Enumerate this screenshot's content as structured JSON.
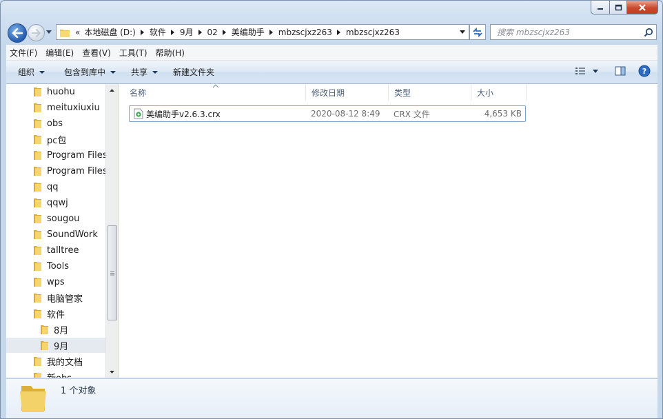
{
  "window": {
    "caption_buttons": [
      "minimize-icon",
      "maximize-icon",
      "close-icon"
    ]
  },
  "nav": {
    "address": {
      "overflow": "«",
      "breadcrumbs": [
        "本地磁盘 (D:)",
        "软件",
        "9月",
        "02",
        "美编助手",
        "mbzscjxz263",
        "mbzscjxz263"
      ]
    },
    "search_placeholder": "搜索 mbzscjxz263"
  },
  "menu": [
    "文件(F)",
    "编辑(E)",
    "查看(V)",
    "工具(T)",
    "帮助(H)"
  ],
  "toolbar": {
    "organize": "组织",
    "include_in_library": "包含到库中",
    "share": "共享",
    "new_folder": "新建文件夹"
  },
  "tree": {
    "items": [
      {
        "label": "huohu",
        "level": 0
      },
      {
        "label": "meituxiuxiu",
        "level": 0
      },
      {
        "label": "obs",
        "level": 0
      },
      {
        "label": "pc包",
        "level": 0
      },
      {
        "label": "Program Files",
        "level": 0
      },
      {
        "label": "Program Files",
        "level": 0
      },
      {
        "label": "qq",
        "level": 0
      },
      {
        "label": "qqwj",
        "level": 0
      },
      {
        "label": "sougou",
        "level": 0
      },
      {
        "label": "SoundWork",
        "level": 0
      },
      {
        "label": "talltree",
        "level": 0
      },
      {
        "label": "Tools",
        "level": 0
      },
      {
        "label": "wps",
        "level": 0
      },
      {
        "label": "电脑管家",
        "level": 0
      },
      {
        "label": "软件",
        "level": 0
      },
      {
        "label": "8月",
        "level": 1
      },
      {
        "label": "9月",
        "level": 1,
        "selected": true
      },
      {
        "label": "我的文档",
        "level": 0
      },
      {
        "label": "新obs",
        "level": 0
      }
    ]
  },
  "columns": [
    "名称",
    "修改日期",
    "类型",
    "大小"
  ],
  "files": [
    {
      "name": "美编助手v2.6.3.crx",
      "modified": "2020-08-12 8:49",
      "type": "CRX 文件",
      "size": "4,653 KB"
    }
  ],
  "status": {
    "count_text": "1 个对象"
  }
}
